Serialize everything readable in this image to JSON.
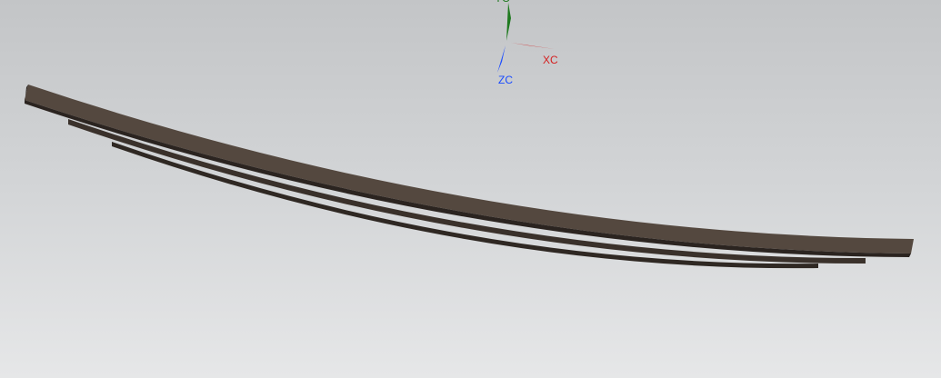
{
  "viewport": {
    "triad": {
      "x_label": "XC",
      "y_label": "YC",
      "z_label": "ZC",
      "x_color": "#d42020",
      "y_color": "#1f7a1f",
      "z_color": "#1a4cff"
    },
    "model": {
      "name": "leaf-spring",
      "color": "#54483f",
      "leaf_count": 3
    }
  }
}
